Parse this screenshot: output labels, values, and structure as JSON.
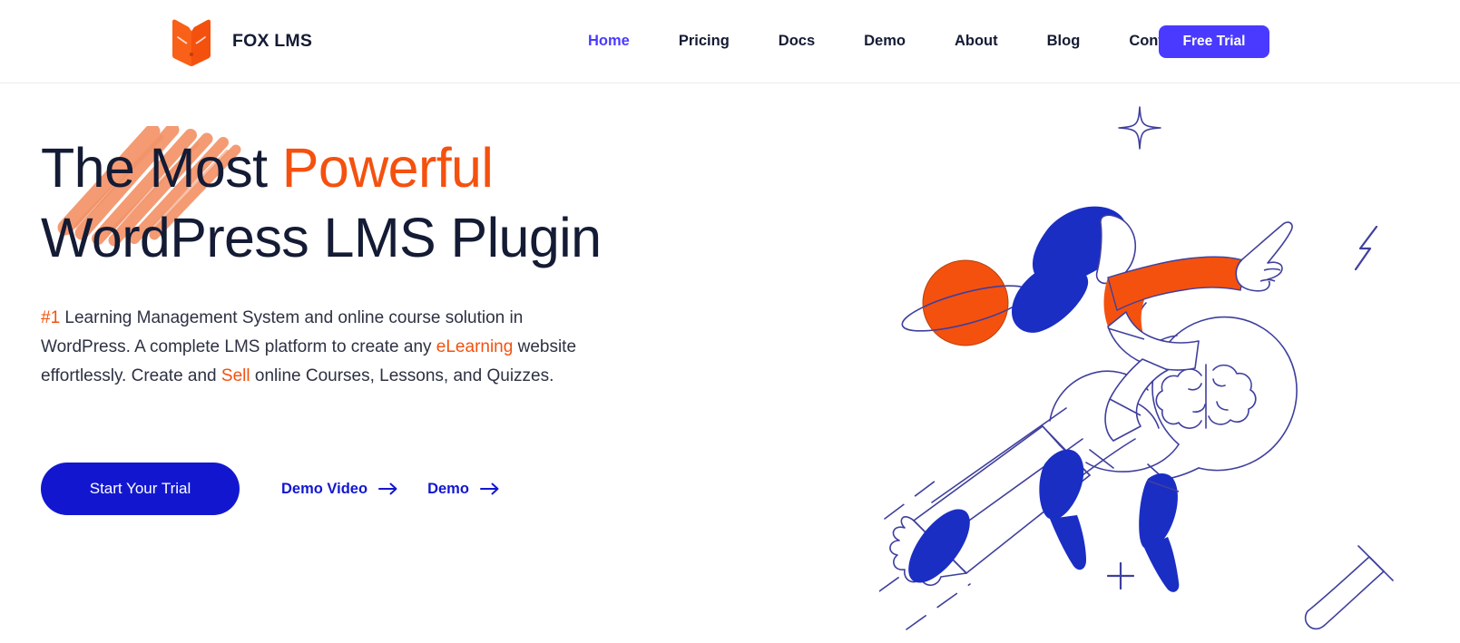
{
  "brand": {
    "name": "FOX LMS",
    "logo_icon": "fox-book-logo-icon",
    "logo_color": "#f4510f"
  },
  "nav": {
    "items": [
      {
        "label": "Home",
        "active": true
      },
      {
        "label": "Pricing",
        "active": false
      },
      {
        "label": "Docs",
        "active": false
      },
      {
        "label": "Demo",
        "active": false
      },
      {
        "label": "About",
        "active": false
      },
      {
        "label": "Blog",
        "active": false
      },
      {
        "label": "Contact Us",
        "active": false
      }
    ],
    "cta_label": "Free Trial",
    "cta_color": "#4a3aff",
    "active_color": "#4a3aff"
  },
  "hero": {
    "headline_line1_plain": "The Most ",
    "headline_line1_accent": "Powerful",
    "headline_line2": "WordPress LMS Plugin",
    "paragraph": {
      "p1_accent": "#1",
      "p1_text": " Learning Management System and online course solution in WordPress. A complete LMS platform to create any ",
      "p2_accent": "eLearning",
      "p2_text": " website effortlessly. Create and ",
      "p3_accent": "Sell",
      "p3_text": " online Courses, Lessons, and Quizzes."
    },
    "primary_cta_label": "Start Your Trial",
    "links": [
      {
        "label": "Demo Video",
        "icon": "arrow-right-icon"
      },
      {
        "label": "Demo",
        "icon": "arrow-right-icon"
      }
    ],
    "accent_color": "#f4510f",
    "primary_button_color": "#1217cf",
    "highlight_color": "#f4966d",
    "illustration": {
      "name": "person-riding-rocket-lightbulb-illustration",
      "elements": [
        "sparkle-icon",
        "planet-icon",
        "lightning-bolt-icon",
        "paintbrush-icon",
        "plus-icon",
        "brain-icon",
        "rocket-icon"
      ],
      "line_color": "#3f3f9e",
      "blue": "#1a2ec4",
      "orange": "#f4510f"
    }
  }
}
